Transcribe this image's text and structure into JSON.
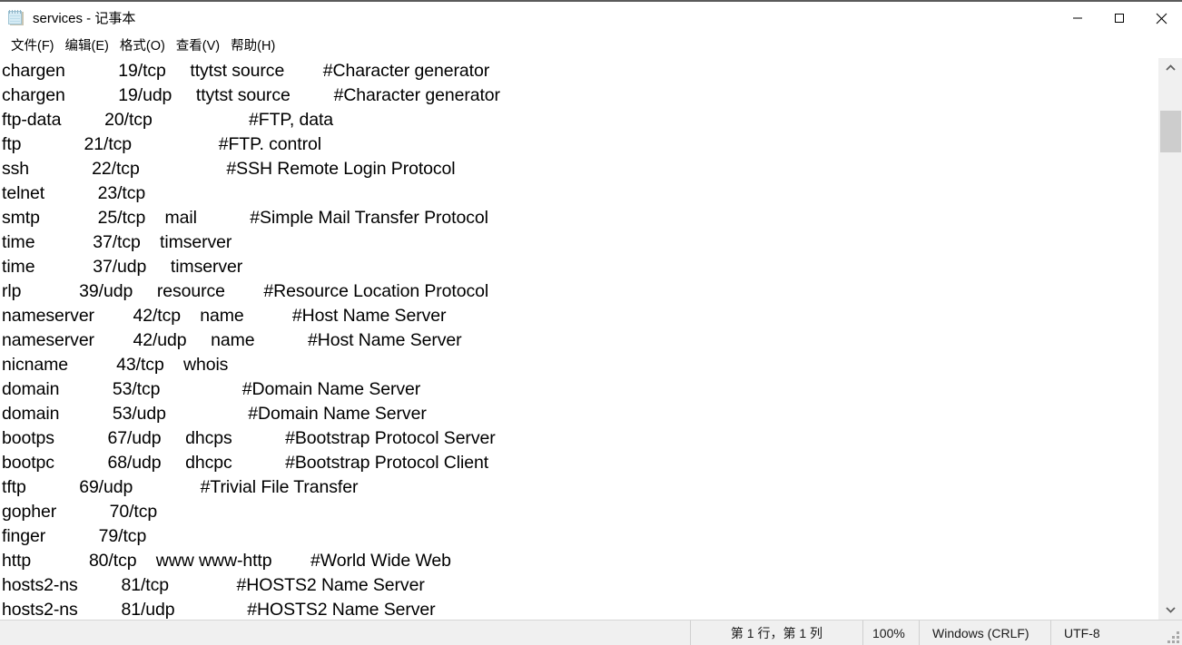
{
  "window": {
    "title": "services - 记事本",
    "app_icon": "notepad-icon",
    "controls": [
      {
        "name": "minimize",
        "glyph": "minimize-icon"
      },
      {
        "name": "maximize",
        "glyph": "maximize-icon"
      },
      {
        "name": "close",
        "glyph": "close-icon"
      }
    ]
  },
  "menubar": {
    "items": [
      {
        "label": "文件(F)"
      },
      {
        "label": "编辑(E)"
      },
      {
        "label": "格式(O)"
      },
      {
        "label": "查看(V)"
      },
      {
        "label": "帮助(H)"
      }
    ]
  },
  "editor": {
    "lines": [
      "chargen           19/tcp     ttytst source        #Character generator",
      "chargen           19/udp     ttytst source         #Character generator",
      "ftp-data         20/tcp                    #FTP, data",
      "ftp             21/tcp                  #FTP. control",
      "ssh             22/tcp                  #SSH Remote Login Protocol",
      "telnet           23/tcp",
      "smtp            25/tcp    mail           #Simple Mail Transfer Protocol",
      "time            37/tcp    timserver",
      "time            37/udp     timserver",
      "rlp            39/udp     resource        #Resource Location Protocol",
      "nameserver        42/tcp    name          #Host Name Server",
      "nameserver        42/udp     name           #Host Name Server",
      "nicname          43/tcp    whois",
      "domain           53/tcp                 #Domain Name Server",
      "domain           53/udp                 #Domain Name Server",
      "bootps           67/udp     dhcps           #Bootstrap Protocol Server",
      "bootpc           68/udp     dhcpc           #Bootstrap Protocol Client",
      "tftp           69/udp              #Trivial File Transfer",
      "gopher           70/tcp",
      "finger           79/tcp",
      "http            80/tcp    www www-http        #World Wide Web",
      "hosts2-ns         81/tcp              #HOSTS2 Name Server",
      "hosts2-ns         81/udp               #HOSTS2 Name Server"
    ]
  },
  "scrollbar": {
    "up_arrow": "chevron-up-icon",
    "down_arrow": "chevron-down-icon",
    "thumb": "scroll-thumb"
  },
  "statusbar": {
    "position": "第 1 行，第 1 列",
    "zoom": "100%",
    "line_ending": "Windows (CRLF)",
    "encoding": "UTF-8",
    "grip": "resize-grip-icon"
  },
  "colors": {
    "window_bg": "#ffffff",
    "chrome_bg": "#f0f0f0",
    "text": "#000000",
    "scroll_thumb": "#cdcdcd",
    "separator": "#d0d0d0"
  }
}
